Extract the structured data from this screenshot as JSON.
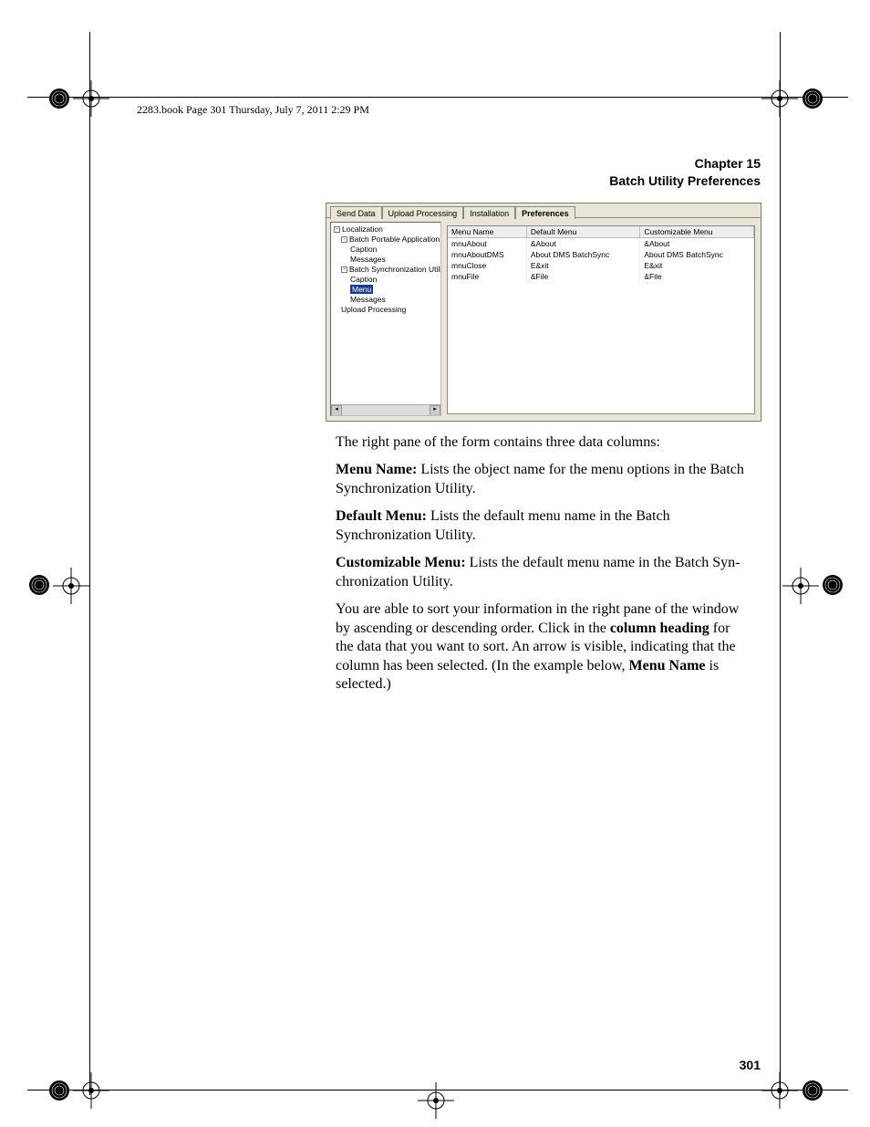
{
  "runhead": "2283.book  Page 301  Thursday, July 7, 2011  2:29 PM",
  "chapter": {
    "line1": "Chapter 15",
    "line2": "Batch Utility Preferences"
  },
  "screenshot": {
    "tabs": [
      "Send Data",
      "Upload Processing",
      "Installation",
      "Preferences"
    ],
    "activeTabIndex": 3,
    "tree": [
      {
        "level": 0,
        "expander": "-",
        "label": "Localization"
      },
      {
        "level": 1,
        "expander": "-",
        "label": "Batch Portable Application"
      },
      {
        "level": 2,
        "expander": "",
        "label": "Caption"
      },
      {
        "level": 2,
        "expander": "",
        "label": "Messages"
      },
      {
        "level": 1,
        "expander": "-",
        "label": "Batch Synchronization Utility"
      },
      {
        "level": 2,
        "expander": "",
        "label": "Caption"
      },
      {
        "level": 2,
        "expander": "",
        "label": "Menu",
        "selected": true
      },
      {
        "level": 2,
        "expander": "",
        "label": "Messages"
      },
      {
        "level": 1,
        "expander": "",
        "label": "Upload Processing"
      }
    ],
    "table": {
      "headers": [
        "Menu Name",
        "Default Menu",
        "Customizable Menu"
      ],
      "rows": [
        [
          "mnuAbout",
          "&About",
          "&About"
        ],
        [
          "mnuAboutDMS",
          "About DMS BatchSync",
          "About DMS BatchSync"
        ],
        [
          "mnuClose",
          "E&xit",
          "E&xit"
        ],
        [
          "mnuFile",
          "&File",
          "&File"
        ]
      ]
    }
  },
  "body": {
    "p1": "The right pane of the form contains three data columns:",
    "p2a": "Menu Name:",
    "p2b": " Lists the object name for the menu options in the Batch Synchronization Utility.",
    "p3a": "Default Menu:",
    "p3b": " Lists the default menu name in the Batch Synchroniza­tion Utility.",
    "p4a": "Customizable Menu:",
    "p4b": " Lists the default menu name in the Batch Syn­chronization Utility.",
    "p5a": "You are able to sort your information in the right pane of the window by ascending or descending order. Click in the ",
    "p5b": "column heading",
    "p5c": " for the data that you want to sort. An arrow is visible, indicating that the col­umn has been selected. (In the example below, ",
    "p5d": "Menu Name",
    "p5e": " is selected.)"
  },
  "pagenum": "301"
}
